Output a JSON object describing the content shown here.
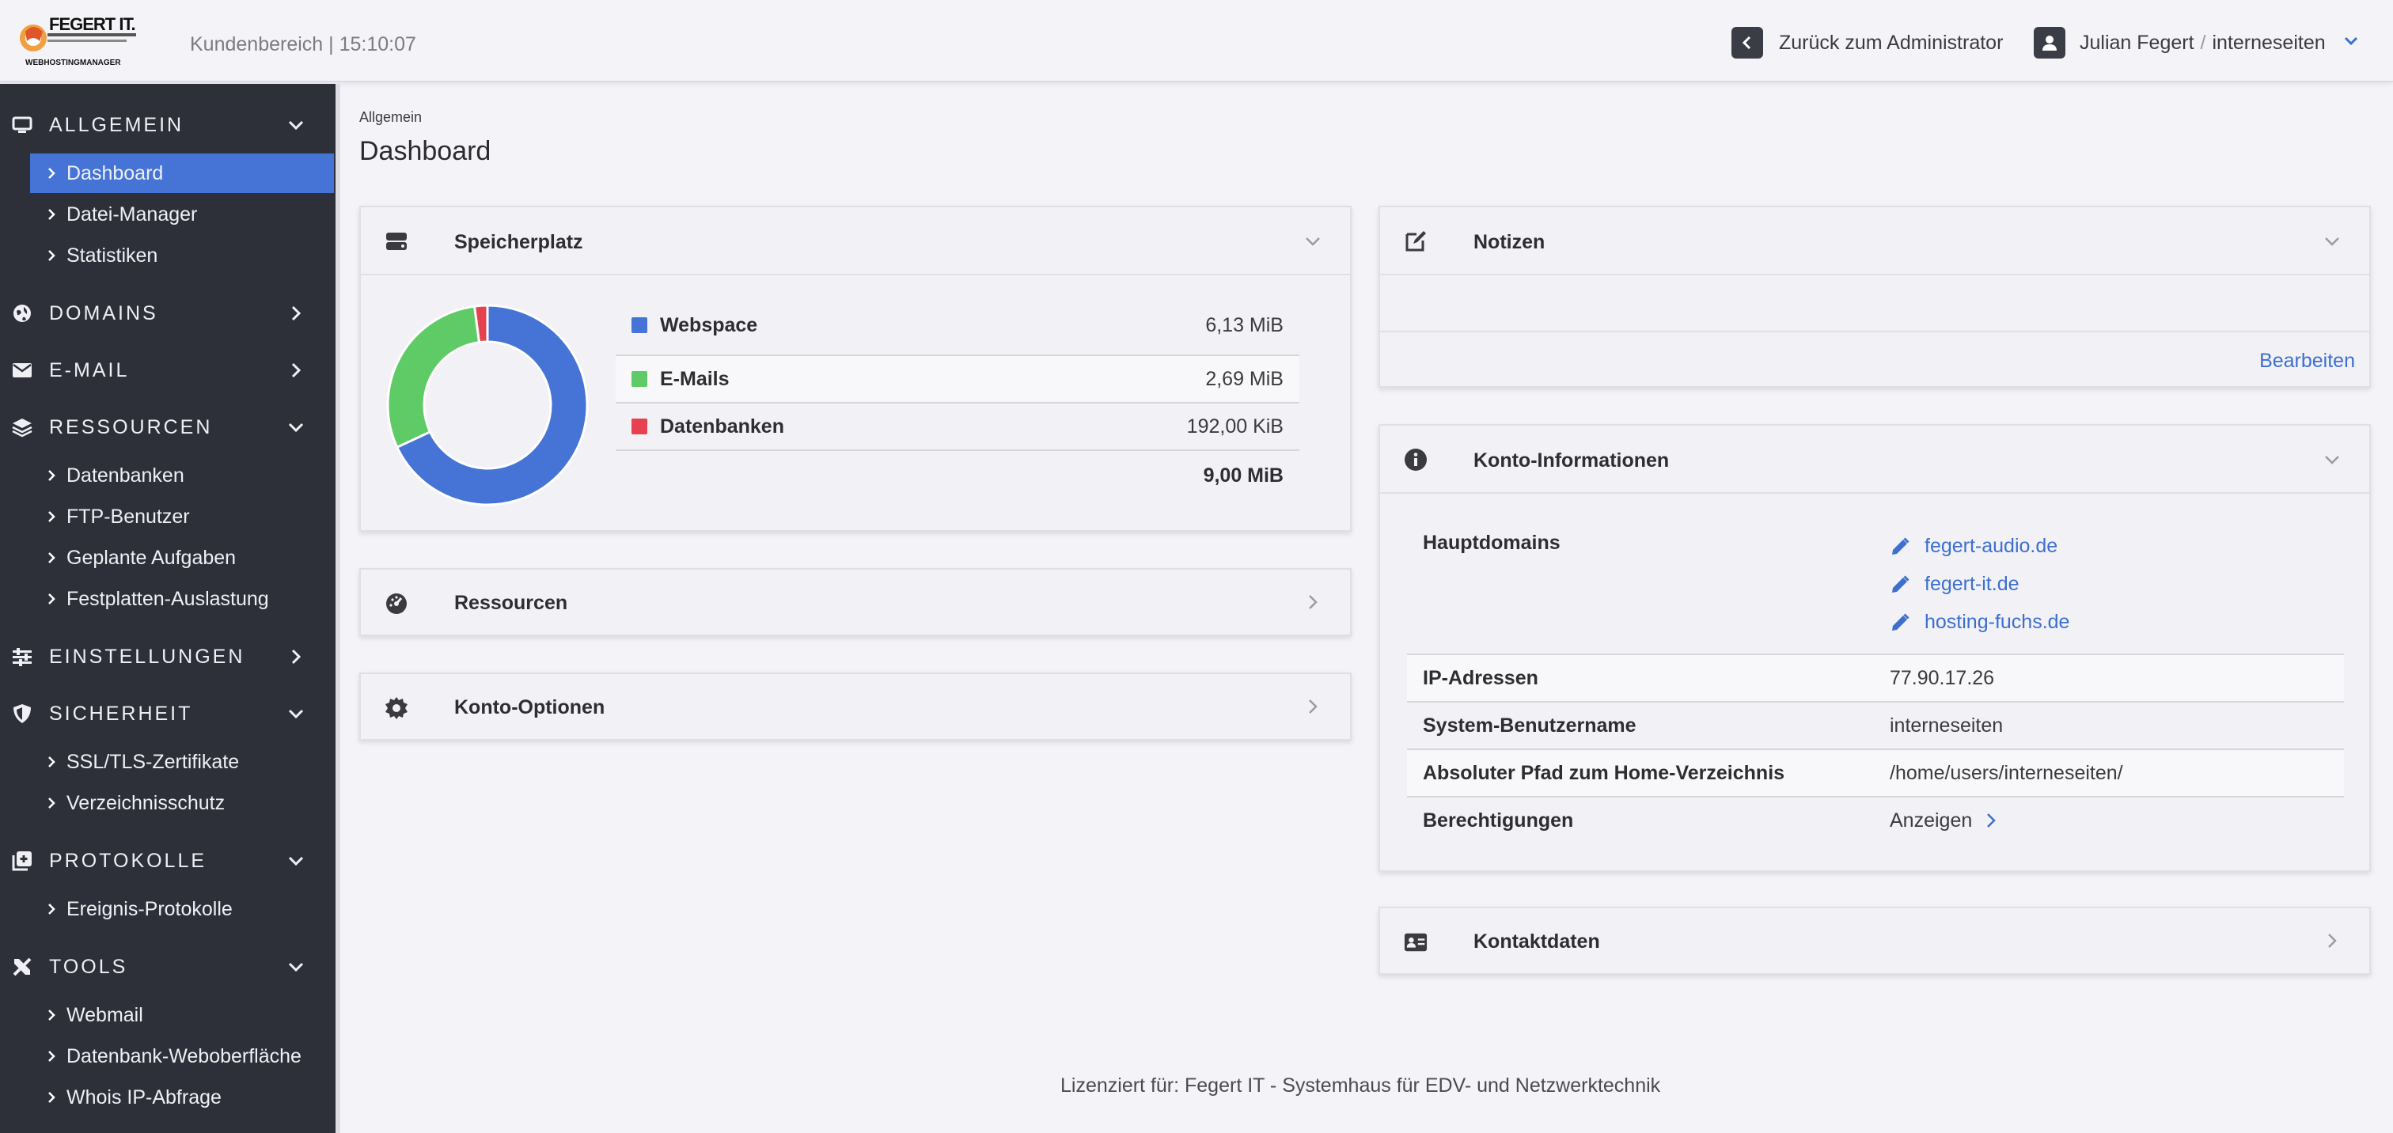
{
  "header": {
    "logo_text": "FEGERT IT.",
    "logo_subtext": "WEBHOSTINGMANAGER",
    "kundenbereich": "Kundenbereich | 15:10:07",
    "back_label": "Zurück zum Administrator",
    "user_name": "Julian Fegert",
    "user_separator": "/",
    "user_account": "interneseiten"
  },
  "sidebar": {
    "sections": [
      {
        "label": "ALLGEMEIN",
        "icon": "monitor-icon",
        "expanded": true,
        "items": [
          "Dashboard",
          "Datei-Manager",
          "Statistiken"
        ]
      },
      {
        "label": "DOMAINS",
        "icon": "globe-icon",
        "expanded": false,
        "items": []
      },
      {
        "label": "E-MAIL",
        "icon": "envelope-icon",
        "expanded": false,
        "items": []
      },
      {
        "label": "RESSOURCEN",
        "icon": "layers-icon",
        "expanded": true,
        "items": [
          "Datenbanken",
          "FTP-Benutzer",
          "Geplante Aufgaben",
          "Festplatten-Auslastung"
        ]
      },
      {
        "label": "EINSTELLUNGEN",
        "icon": "sliders-icon",
        "expanded": false,
        "items": []
      },
      {
        "label": "SICHERHEIT",
        "icon": "shield-icon",
        "expanded": true,
        "items": [
          "SSL/TLS-Zertifikate",
          "Verzeichnisschutz"
        ]
      },
      {
        "label": "PROTOKOLLE",
        "icon": "log-icon",
        "expanded": true,
        "items": [
          "Ereignis-Protokolle"
        ]
      },
      {
        "label": "TOOLS",
        "icon": "tools-icon",
        "expanded": true,
        "items": [
          "Webmail",
          "Datenbank-Weboberfläche",
          "Whois IP-Abfrage"
        ]
      }
    ],
    "active_item": "Dashboard"
  },
  "main": {
    "breadcrumb": "Allgemein",
    "title": "Dashboard"
  },
  "cards": {
    "speicherplatz": {
      "title": "Speicherplatz",
      "legend": [
        {
          "name": "Webspace",
          "value": "6,13 MiB",
          "color": "#4574d6"
        },
        {
          "name": "E-Mails",
          "value": "2,69 MiB",
          "color": "#5fcb66"
        },
        {
          "name": "Datenbanken",
          "value": "192,00 KiB",
          "color": "#e5414f"
        }
      ],
      "total": "9,00 MiB"
    },
    "ressourcen": {
      "title": "Ressourcen"
    },
    "konto_optionen": {
      "title": "Konto-Optionen"
    },
    "notizen": {
      "title": "Notizen",
      "edit_label": "Bearbeiten"
    },
    "konto_info": {
      "title": "Konto-Informationen",
      "hauptdomains_label": "Hauptdomains",
      "domains": [
        "fegert-audio.de",
        "fegert-it.de",
        "hosting-fuchs.de"
      ],
      "rows": [
        {
          "key": "IP-Adressen",
          "value": "77.90.17.26"
        },
        {
          "key": "System-Benutzername",
          "value": "interneseiten"
        },
        {
          "key": "Absoluter Pfad zum Home-Verzeichnis",
          "value": "/home/users/interneseiten/"
        }
      ],
      "berechtigungen_label": "Berechtigungen",
      "berechtigungen_link": "Anzeigen"
    },
    "kontaktdaten": {
      "title": "Kontaktdaten"
    }
  },
  "footer": {
    "text": "Lizenziert für: Fegert IT - Systemhaus für EDV- und Netzwerktechnik"
  },
  "chart_data": {
    "type": "pie",
    "categories": [
      "Webspace",
      "E-Mails",
      "Datenbanken"
    ],
    "values": [
      6.13,
      2.69,
      0.1875
    ],
    "unit": "MiB",
    "colors": [
      "#4574d6",
      "#5fcb66",
      "#e5414f"
    ]
  }
}
